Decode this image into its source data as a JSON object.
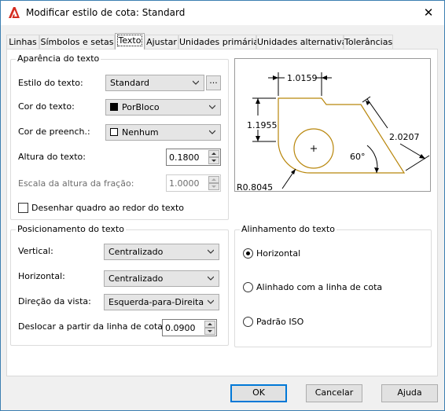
{
  "window": {
    "title": "Modificar estilo de cota: Standard",
    "close_glyph": "✕"
  },
  "tabs": [
    {
      "label": "Linhas"
    },
    {
      "label": "Símbolos e setas"
    },
    {
      "label": "Texto"
    },
    {
      "label": "Ajustar"
    },
    {
      "label": "Unidades primárias"
    },
    {
      "label": "Unidades alternativas"
    },
    {
      "label": "Tolerâncias"
    }
  ],
  "active_tab": "Texto",
  "appearance": {
    "title": "Aparência do texto",
    "text_style_label": "Estilo do texto:",
    "text_style_value": "Standard",
    "browse_label": "...",
    "text_color_label": "Cor do texto:",
    "text_color_value": "PorBloco",
    "fill_color_label": "Cor de preench.:",
    "fill_color_value": "Nenhum",
    "text_height_label": "Altura do texto:",
    "text_height_value": "0.1800",
    "fraction_scale_label": "Escala da altura da fração:",
    "fraction_scale_value": "1.0000",
    "draw_frame_label": "Desenhar quadro ao redor do texto",
    "draw_frame_checked": false
  },
  "placement": {
    "title": "Posicionamento do texto",
    "vertical_label": "Vertical:",
    "vertical_value": "Centralizado",
    "horizontal_label": "Horizontal:",
    "horizontal_value": "Centralizado",
    "view_direction_label": "Direção da vista:",
    "view_direction_value": "Esquerda-para-Direita",
    "offset_label": "Deslocar a partir da linha de cota:",
    "offset_value": "0.0900"
  },
  "alignment": {
    "title": "Alinhamento do texto",
    "options": [
      {
        "label": "Horizontal",
        "selected": true
      },
      {
        "label": "Alinhado com a linha de cota",
        "selected": false
      },
      {
        "label": "Padrão ISO",
        "selected": false
      }
    ]
  },
  "preview": {
    "dim_top": "1.0159",
    "dim_left": "1.1955",
    "dim_right": "2.0207",
    "dim_angle": "60°",
    "dim_radius": "R0.8045"
  },
  "buttons": {
    "ok": "OK",
    "cancel": "Cancelar",
    "help": "Ajuda"
  },
  "colors": {
    "accent": "#0078d7",
    "geometry": "#b8860b",
    "autocad_red": "#d52b1e"
  }
}
